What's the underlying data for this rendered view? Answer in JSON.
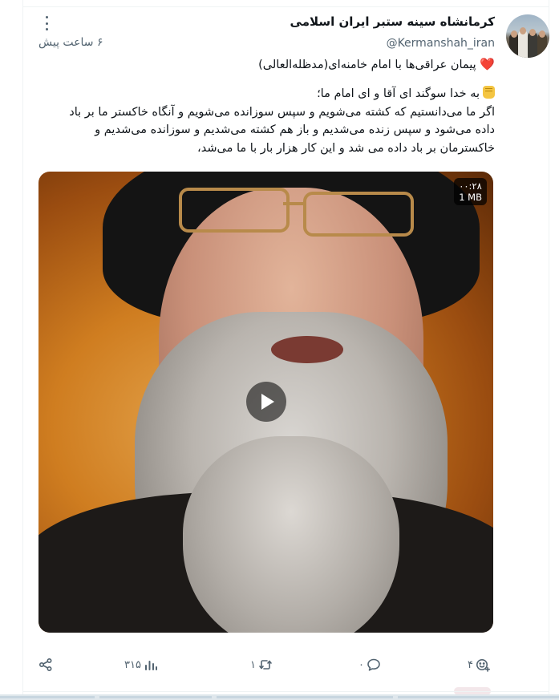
{
  "post": {
    "author_name": "کرمانشاه سینه ستبر ایران اسلامی",
    "handle": "@Kermanshah_iran",
    "timestamp": "۶ ساعت پیش",
    "line1": "پیمان عراقی‌ها با امام خامنه‌ای(مدظله‌العالی)",
    "para_lines": [
      "به خدا سوگند ای آقا و ای امام ما؛",
      "اگر ما می‌دانستیم که کشته می‌شویم و سپس سوزانده می‌شویم و آنگاه خاکستر ما بر باد",
      "داده می‌شود و سپس زنده می‌شدیم و باز هم کشته می‌شدیم و سوزانده می‌شدیم و",
      "خاکسترمان بر باد داده می شد و این کار هزار بار با ما می‌شد،"
    ],
    "emoji_line1": "heart-emoji",
    "emoji_para": "raised-fist-emoji"
  },
  "video": {
    "duration": "۰۰:۲۸",
    "size": "1 MB",
    "play_icon": "play-icon"
  },
  "actions": {
    "views": "۳۱۵",
    "retweets": "۱",
    "replies": "۰",
    "likes": "۴",
    "icons": [
      "share-icon",
      "views-icon",
      "retweet-icon",
      "reply-icon",
      "like-icon"
    ]
  },
  "colors": {
    "text_primary": "#0f1419",
    "text_secondary": "#536471",
    "heart": "#e0245e"
  }
}
